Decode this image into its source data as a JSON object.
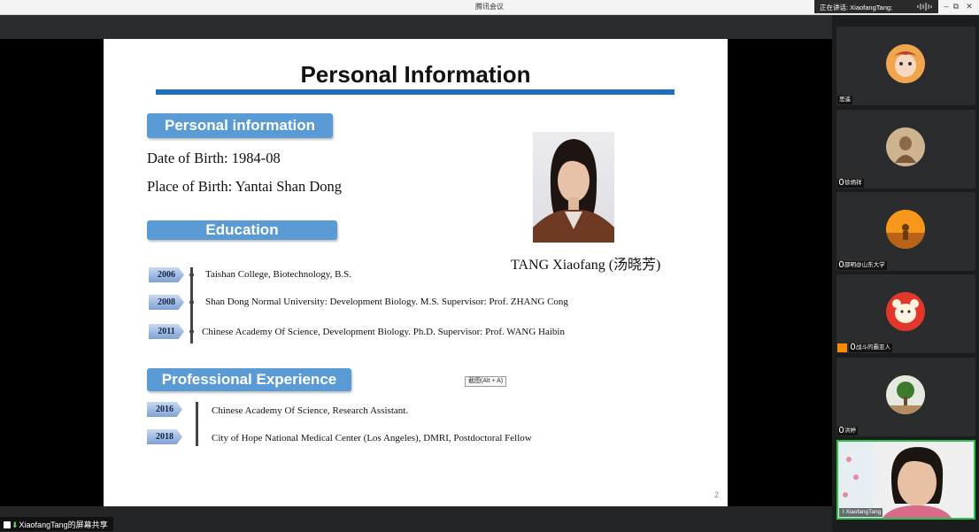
{
  "window": {
    "title": "腾讯会议",
    "speaking": "正在讲话: XiaofangTang;"
  },
  "share_label": "XiaofangTang的屏幕共享",
  "slide": {
    "title": "Personal Information",
    "section_personal": "Personal information",
    "date_of_birth": "Date of Birth: 1984-08",
    "place_of_birth": "Place of Birth: Yantai Shan Dong",
    "section_education": "Education",
    "education": [
      {
        "year": "2006",
        "text": "Taishan College, Biotechnology, B.S."
      },
      {
        "year": "2008",
        "text": "Shan Dong Normal University: Development Biology.  M.S. Supervisor: Prof.  ZHANG Cong"
      },
      {
        "year": "2011",
        "text": "Chinese Academy Of  Science, Development Biology. Ph.D. Supervisor: Prof.  WANG Haibin"
      }
    ],
    "section_experience": "Professional Experience",
    "experience": [
      {
        "year": "2016",
        "text": "Chinese Academy Of  Science, Research Assistant."
      },
      {
        "year": "2018",
        "text": "City of Hope National Medical Center (Los Angeles), DMRI, Postdoctoral Fellow"
      }
    ],
    "caption": "TANG Xiaofang (汤晓芳)",
    "tooltip": "截图(Alt + A)",
    "page_number": "2"
  },
  "participants": [
    {
      "name": "思遥",
      "muted": false
    },
    {
      "name": "徐炳祥",
      "muted": true
    },
    {
      "name": "邵明@山东大学",
      "muted": true
    },
    {
      "name": "战斗的霸亚人",
      "muted": true
    },
    {
      "name": "洪婷",
      "muted": true
    },
    {
      "name": "XiaofangTang",
      "muted": false,
      "speaking": true
    }
  ],
  "colors": {
    "accent_blue": "#1f6dbf",
    "section_blue": "#5b9bd5",
    "speaker_border": "#27c24c"
  }
}
